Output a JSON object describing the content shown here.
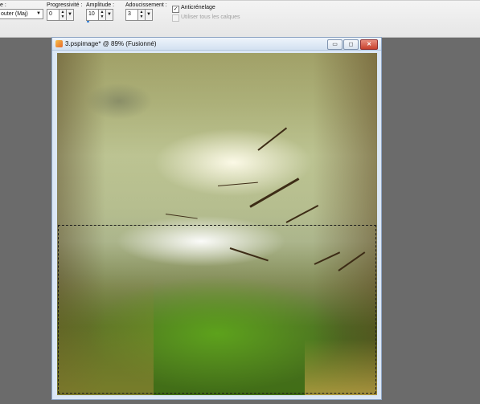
{
  "toolbar": {
    "mode": {
      "label": "e :",
      "value": "outer (Maj)"
    },
    "progressivite": {
      "label": "Progressivité :",
      "value": "0"
    },
    "amplitude": {
      "label": "Amplitude :",
      "value": "10",
      "level": 0.1
    },
    "adoucissement": {
      "label": "Adoucissement :",
      "value": "3"
    },
    "anticrenelage": {
      "label": "Anticrénelage",
      "checked": true
    },
    "tous_calques": {
      "label": "Utiliser tous les calques",
      "checked": false,
      "disabled": true
    }
  },
  "document": {
    "title": "3.pspimage* @ 89% (Fusionné)",
    "buttons": {
      "minimize": "▭",
      "restore": "◻",
      "close": "✕"
    }
  },
  "colors": {
    "workspace": "#6b6b6b",
    "toolbar": "#ececec",
    "window_frame": "#dbe7f5",
    "close_button": "#c7402c",
    "slider_accent": "#3d86d8"
  },
  "icons": {
    "document": "paint-shop-pro-document-icon",
    "checkbox_checked": "checkmark"
  }
}
